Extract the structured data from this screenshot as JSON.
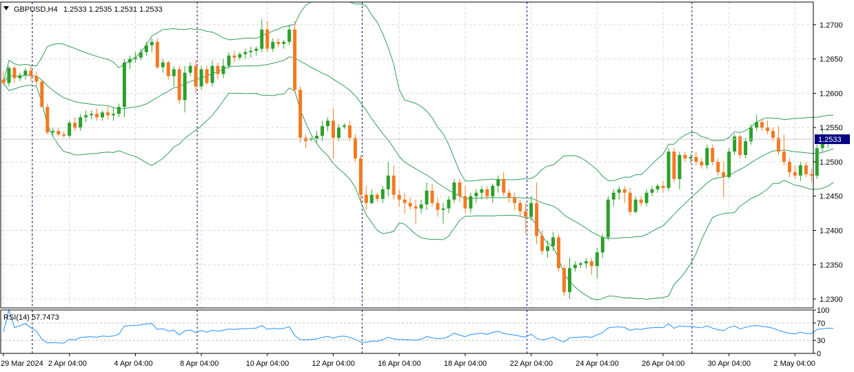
{
  "chart_data": [
    {
      "type": "candlestick",
      "symbol_label": "GBPUSD,H4",
      "ohlc_header": "1.2533 1.2535 1.2531 1.2533",
      "current_price_label": "1.2533",
      "current_price": 1.2533,
      "y_tick_labels": [
        "1.2700",
        "1.2650",
        "1.2600",
        "1.2550",
        "1.2500",
        "1.2450",
        "1.2400",
        "1.2350",
        "1.2300"
      ],
      "y_ticks": [
        1.27,
        1.265,
        1.26,
        1.255,
        1.25,
        1.245,
        1.24,
        1.235,
        1.23
      ],
      "ylim": [
        1.2287,
        1.2733
      ],
      "x_tick_labels": [
        "29 Mar 2024",
        "2 Apr 04:00",
        "4 Apr 04:00",
        "8 Apr 04:00",
        "10 Apr 04:00",
        "12 Apr 04:00",
        "16 Apr 04:00",
        "18 Apr 04:00",
        "22 Apr 04:00",
        "24 Apr 04:00",
        "26 Apr 04:00",
        "30 Apr 04:00",
        "2 May 04:00"
      ],
      "x_tick_bars": [
        0,
        12,
        24,
        36,
        48,
        60,
        72,
        84,
        96,
        108,
        120,
        132,
        144
      ],
      "week_separator_bars": [
        5,
        35,
        65,
        95,
        125
      ],
      "grid": true,
      "up_color": "#2ca02c",
      "down_color": "#f47920",
      "bands_color": "#2e9e57",
      "candles": [
        [
          1.262,
          1.2632,
          1.2612,
          1.2615
        ],
        [
          1.2615,
          1.264,
          1.261,
          1.2637
        ],
        [
          1.2637,
          1.264,
          1.2615,
          1.2622
        ],
        [
          1.2622,
          1.263,
          1.2618,
          1.2626
        ],
        [
          1.2626,
          1.2637,
          1.262,
          1.2633
        ],
        [
          1.2633,
          1.264,
          1.2618,
          1.2625
        ],
        [
          1.2625,
          1.2632,
          1.261,
          1.2617
        ],
        [
          1.2617,
          1.262,
          1.258,
          1.258
        ],
        [
          1.258,
          1.2585,
          1.254,
          1.2543
        ],
        [
          1.2543,
          1.255,
          1.2537,
          1.2545
        ],
        [
          1.2545,
          1.255,
          1.2537,
          1.254
        ],
        [
          1.254,
          1.2545,
          1.2535,
          1.2538
        ],
        [
          1.2538,
          1.256,
          1.2535,
          1.2557
        ],
        [
          1.2557,
          1.2565,
          1.2545,
          1.255
        ],
        [
          1.255,
          1.257,
          1.2545,
          1.2565
        ],
        [
          1.2565,
          1.2575,
          1.2558,
          1.2568
        ],
        [
          1.2568,
          1.2575,
          1.2562,
          1.257
        ],
        [
          1.257,
          1.2578,
          1.256,
          1.2565
        ],
        [
          1.2565,
          1.2575,
          1.256,
          1.2572
        ],
        [
          1.2572,
          1.258,
          1.2562,
          1.2568
        ],
        [
          1.2568,
          1.258,
          1.256,
          1.257
        ],
        [
          1.257,
          1.2585,
          1.2565,
          1.258
        ],
        [
          1.258,
          1.265,
          1.2565,
          1.2645
        ],
        [
          1.2645,
          1.2655,
          1.2635,
          1.265
        ],
        [
          1.265,
          1.266,
          1.2645,
          1.2652
        ],
        [
          1.2652,
          1.2665,
          1.2648,
          1.266
        ],
        [
          1.266,
          1.2675,
          1.2655,
          1.267
        ],
        [
          1.267,
          1.268,
          1.266,
          1.2675
        ],
        [
          1.2675,
          1.268,
          1.2635,
          1.2638
        ],
        [
          1.2638,
          1.265,
          1.263,
          1.2645
        ],
        [
          1.2645,
          1.2648,
          1.262,
          1.2625
        ],
        [
          1.2625,
          1.264,
          1.261,
          1.2635
        ],
        [
          1.2635,
          1.264,
          1.2585,
          1.259
        ],
        [
          1.259,
          1.264,
          1.2572,
          1.263
        ],
        [
          1.263,
          1.2645,
          1.2625,
          1.264
        ],
        [
          1.264,
          1.2648,
          1.26,
          1.261
        ],
        [
          1.261,
          1.264,
          1.2605,
          1.2635
        ],
        [
          1.2635,
          1.264,
          1.2612,
          1.2615
        ],
        [
          1.2615,
          1.2648,
          1.261,
          1.264
        ],
        [
          1.264,
          1.2645,
          1.262,
          1.2628
        ],
        [
          1.2628,
          1.265,
          1.2622,
          1.264
        ],
        [
          1.264,
          1.266,
          1.2635,
          1.2655
        ],
        [
          1.2655,
          1.2662,
          1.2645,
          1.2652
        ],
        [
          1.2652,
          1.266,
          1.2648,
          1.2657
        ],
        [
          1.2657,
          1.2665,
          1.265,
          1.266
        ],
        [
          1.266,
          1.2668,
          1.2652,
          1.2662
        ],
        [
          1.2662,
          1.2668,
          1.2655,
          1.2665
        ],
        [
          1.2665,
          1.2708,
          1.266,
          1.2693
        ],
        [
          1.2693,
          1.2705,
          1.266,
          1.2665
        ],
        [
          1.2665,
          1.268,
          1.266,
          1.2675
        ],
        [
          1.2675,
          1.268,
          1.2667,
          1.2672
        ],
        [
          1.2672,
          1.2678,
          1.2665,
          1.2675
        ],
        [
          1.2675,
          1.27,
          1.267,
          1.2693
        ],
        [
          1.2693,
          1.2705,
          1.26,
          1.2605
        ],
        [
          1.2605,
          1.261,
          1.2528,
          1.2535
        ],
        [
          1.2535,
          1.254,
          1.252,
          1.253
        ],
        [
          1.2532,
          1.2536,
          1.253,
          1.2534
        ],
        [
          1.2534,
          1.2545,
          1.2528,
          1.2538
        ],
        [
          1.2538,
          1.256,
          1.253,
          1.2552
        ],
        [
          1.2552,
          1.2565,
          1.2545,
          1.256
        ],
        [
          1.256,
          1.2578,
          1.2505,
          1.2535
        ],
        [
          1.2535,
          1.2555,
          1.253,
          1.255
        ],
        [
          1.2551,
          1.2556,
          1.2548,
          1.2553
        ],
        [
          1.2553,
          1.256,
          1.253,
          1.2535
        ],
        [
          1.2535,
          1.254,
          1.25,
          1.2505
        ],
        [
          1.2505,
          1.251,
          1.244,
          1.2452
        ],
        [
          1.2452,
          1.2465,
          1.243,
          1.244
        ],
        [
          1.244,
          1.246,
          1.2438,
          1.2452
        ],
        [
          1.2452,
          1.2455,
          1.2442,
          1.2446
        ],
        [
          1.2446,
          1.2465,
          1.244,
          1.246
        ],
        [
          1.246,
          1.25,
          1.245,
          1.248
        ],
        [
          1.248,
          1.2495,
          1.2445,
          1.2452
        ],
        [
          1.2452,
          1.246,
          1.2435,
          1.2445
        ],
        [
          1.2445,
          1.2455,
          1.2425,
          1.244
        ],
        [
          1.244,
          1.2448,
          1.243,
          1.2435
        ],
        [
          1.2435,
          1.2445,
          1.241,
          1.2432
        ],
        [
          1.2432,
          1.2445,
          1.2425,
          1.2438
        ],
        [
          1.2438,
          1.247,
          1.243,
          1.2458
        ],
        [
          1.2458,
          1.2468,
          1.2435,
          1.244
        ],
        [
          1.244,
          1.2448,
          1.242,
          1.243
        ],
        [
          1.243,
          1.244,
          1.241,
          1.2432
        ],
        [
          1.2432,
          1.245,
          1.2425,
          1.2445
        ],
        [
          1.2445,
          1.2475,
          1.244,
          1.247
        ],
        [
          1.247,
          1.2475,
          1.2442,
          1.245
        ],
        [
          1.245,
          1.2465,
          1.2425,
          1.2432
        ],
        [
          1.2432,
          1.2455,
          1.2425,
          1.245
        ],
        [
          1.245,
          1.246,
          1.244,
          1.2455
        ],
        [
          1.2455,
          1.2465,
          1.2445,
          1.246
        ],
        [
          1.246,
          1.2465,
          1.2445,
          1.245
        ],
        [
          1.245,
          1.2468,
          1.244,
          1.2465
        ],
        [
          1.2465,
          1.248,
          1.2455,
          1.2475
        ],
        [
          1.2475,
          1.2485,
          1.245,
          1.2455
        ],
        [
          1.2455,
          1.246,
          1.244,
          1.2448
        ],
        [
          1.2448,
          1.2455,
          1.243,
          1.244
        ],
        [
          1.244,
          1.2445,
          1.242,
          1.2428
        ],
        [
          1.2428,
          1.244,
          1.2395,
          1.242
        ],
        [
          1.242,
          1.245,
          1.2415,
          1.244
        ],
        [
          1.244,
          1.247,
          1.238,
          1.2392
        ],
        [
          1.2392,
          1.24,
          1.2365,
          1.237
        ],
        [
          1.237,
          1.2385,
          1.236,
          1.2377
        ],
        [
          1.2377,
          1.2398,
          1.237,
          1.239
        ],
        [
          1.239,
          1.2395,
          1.234,
          1.2345
        ],
        [
          1.2345,
          1.235,
          1.2305,
          1.231
        ],
        [
          1.231,
          1.236,
          1.23,
          1.2345
        ],
        [
          1.2345,
          1.2355,
          1.234,
          1.235
        ],
        [
          1.235,
          1.2355,
          1.2345,
          1.2352
        ],
        [
          1.2352,
          1.236,
          1.2345,
          1.2355
        ],
        [
          1.2355,
          1.236,
          1.2335,
          1.2348
        ],
        [
          1.2348,
          1.2375,
          1.233,
          1.2368
        ],
        [
          1.2368,
          1.2395,
          1.236,
          1.239
        ],
        [
          1.239,
          1.245,
          1.2385,
          1.2445
        ],
        [
          1.2445,
          1.246,
          1.2435,
          1.2455
        ],
        [
          1.2455,
          1.2465,
          1.2445,
          1.246
        ],
        [
          1.246,
          1.2465,
          1.244,
          1.2455
        ],
        [
          1.2455,
          1.2462,
          1.2422,
          1.2427
        ],
        [
          1.2427,
          1.245,
          1.2425,
          1.2445
        ],
        [
          1.2445,
          1.245,
          1.2435,
          1.244
        ],
        [
          1.244,
          1.246,
          1.2435,
          1.2455
        ],
        [
          1.2455,
          1.2465,
          1.245,
          1.246
        ],
        [
          1.246,
          1.2468,
          1.2455,
          1.2465
        ],
        [
          1.2465,
          1.2472,
          1.2455,
          1.2462
        ],
        [
          1.2462,
          1.252,
          1.2458,
          1.2515
        ],
        [
          1.2515,
          1.252,
          1.247,
          1.2475
        ],
        [
          1.2475,
          1.2515,
          1.246,
          1.251
        ],
        [
          1.251,
          1.2515,
          1.25,
          1.2505
        ],
        [
          1.2505,
          1.2512,
          1.2498,
          1.2507
        ],
        [
          1.2507,
          1.2515,
          1.2495,
          1.25
        ],
        [
          1.25,
          1.2505,
          1.249,
          1.2495
        ],
        [
          1.2495,
          1.2525,
          1.249,
          1.252
        ],
        [
          1.252,
          1.2525,
          1.2495,
          1.25
        ],
        [
          1.25,
          1.2505,
          1.248,
          1.2485
        ],
        [
          1.2485,
          1.25,
          1.2448,
          1.2478
        ],
        [
          1.2478,
          1.252,
          1.2475,
          1.2515
        ],
        [
          1.2515,
          1.254,
          1.251,
          1.2537
        ],
        [
          1.2537,
          1.254,
          1.2505,
          1.251
        ],
        [
          1.251,
          1.2535,
          1.2505,
          1.253
        ],
        [
          1.253,
          1.2555,
          1.2525,
          1.255
        ],
        [
          1.255,
          1.2568,
          1.2545,
          1.2558
        ],
        [
          1.2558,
          1.2562,
          1.2545,
          1.255
        ],
        [
          1.255,
          1.256,
          1.254,
          1.2545
        ],
        [
          1.2545,
          1.255,
          1.253,
          1.2535
        ],
        [
          1.2535,
          1.2552,
          1.251,
          1.2515
        ],
        [
          1.2515,
          1.254,
          1.2495,
          1.25
        ],
        [
          1.25,
          1.2505,
          1.2478,
          1.2485
        ],
        [
          1.2485,
          1.2495,
          1.2475,
          1.248
        ],
        [
          1.248,
          1.25,
          1.2472,
          1.2495
        ],
        [
          1.2495,
          1.25,
          1.2478,
          1.2482
        ],
        [
          1.2482,
          1.249,
          1.247,
          1.248
        ],
        [
          1.248,
          1.2525,
          1.2475,
          1.252
        ],
        [
          1.252,
          1.255,
          1.2515,
          1.2528
        ],
        [
          1.2528,
          1.254,
          1.252,
          1.2535
        ],
        [
          1.2533,
          1.2535,
          1.2531,
          1.2533
        ]
      ]
    },
    {
      "type": "line",
      "label": "RSI(14) 57.7473",
      "ylim": [
        0,
        100
      ],
      "levels": [
        70,
        30
      ],
      "y_tick_labels": [
        "100",
        "70",
        "30",
        "0"
      ],
      "y_ticks": [
        100,
        70,
        30,
        0
      ],
      "line_color": "#1e90ff"
    }
  ]
}
